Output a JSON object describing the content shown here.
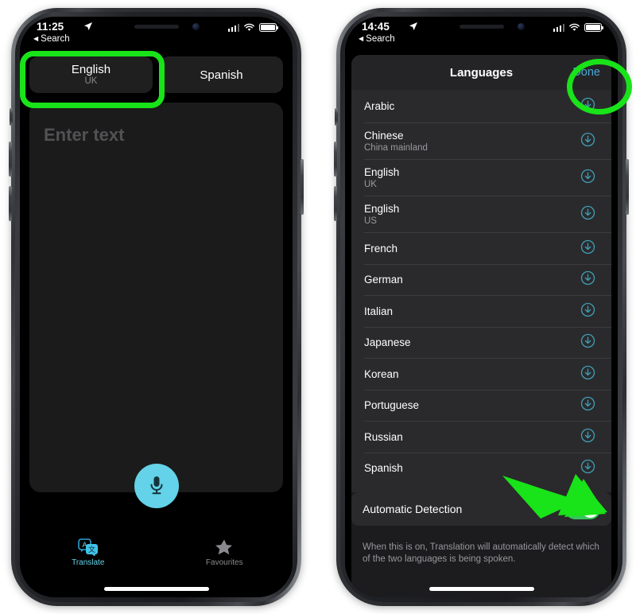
{
  "phones": {
    "left": {
      "status": {
        "time": "11:25",
        "location_icon": "location-arrow-icon",
        "back_label": "Search",
        "signal_icon": "cellular-signal-icon",
        "wifi_icon": "wifi-icon",
        "battery_icon": "battery-full-icon"
      },
      "language_pills": [
        {
          "name": "English",
          "region": "UK",
          "highlighted": true
        },
        {
          "name": "Spanish",
          "region": "",
          "highlighted": false
        }
      ],
      "input": {
        "placeholder": "Enter text"
      },
      "mic_button": {
        "icon": "microphone-icon"
      },
      "tabs": [
        {
          "label": "Translate",
          "icon": "translate-icon",
          "active": true
        },
        {
          "label": "Favourites",
          "icon": "star-icon",
          "active": false
        }
      ]
    },
    "right": {
      "status": {
        "time": "14:45",
        "location_icon": "location-arrow-icon",
        "back_label": "Search",
        "signal_icon": "cellular-signal-icon",
        "wifi_icon": "wifi-icon",
        "battery_icon": "battery-full-icon"
      },
      "sheet": {
        "title": "Languages",
        "done_label": "Done"
      },
      "languages": [
        {
          "name": "Arabic",
          "region": "",
          "download": true,
          "clipped": true
        },
        {
          "name": "Chinese",
          "region": "China mainland",
          "download": true
        },
        {
          "name": "English",
          "region": "UK",
          "download": true
        },
        {
          "name": "English",
          "region": "US",
          "download": true
        },
        {
          "name": "French",
          "region": "",
          "download": true
        },
        {
          "name": "German",
          "region": "",
          "download": true
        },
        {
          "name": "Italian",
          "region": "",
          "download": true
        },
        {
          "name": "Japanese",
          "region": "",
          "download": true
        },
        {
          "name": "Korean",
          "region": "",
          "download": true
        },
        {
          "name": "Portuguese",
          "region": "",
          "download": true
        },
        {
          "name": "Russian",
          "region": "",
          "download": true
        },
        {
          "name": "Spanish",
          "region": "",
          "download": true
        }
      ],
      "automatic_detection": {
        "label": "Automatic Detection",
        "state": "on"
      },
      "footnote": "When this is on, Translation will automatically detect which of the two languages is being spoken."
    }
  },
  "annotations": {
    "highlight_color": "#19e319",
    "items": [
      {
        "name": "english-pill-highlight",
        "shape": "rounded-rect"
      },
      {
        "name": "done-button-highlight",
        "shape": "ellipse"
      },
      {
        "name": "automatic-detection-arrow",
        "shape": "arrow"
      }
    ]
  },
  "colors": {
    "accent_cyan": "#64d2e8",
    "link_blue": "#4aa8d8",
    "switch_green": "#34c759",
    "list_bg": "#2a2a2c",
    "sheet_bg": "#1c1c1e"
  }
}
